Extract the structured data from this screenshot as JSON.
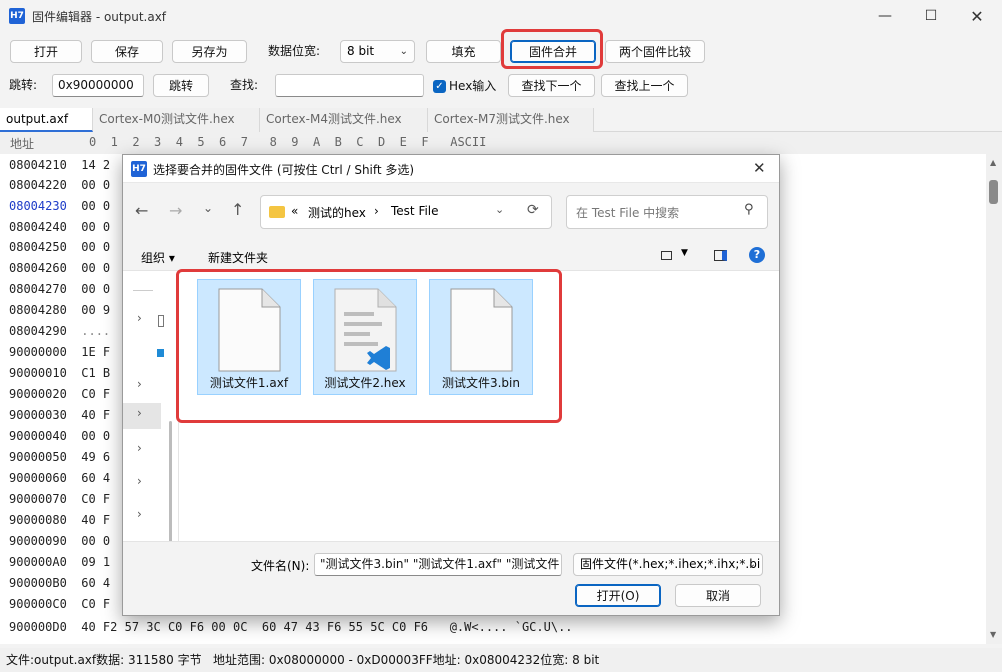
{
  "window": {
    "icon": "H7",
    "title": "固件编辑器 - output.axf",
    "min_icon": "minimize-icon",
    "max_icon": "maximize-icon",
    "close_icon": "close-icon"
  },
  "toolbar": {
    "open": "打开",
    "save": "保存",
    "save_as": "另存为",
    "width_label": "数据位宽:",
    "width_value": "8 bit",
    "fill": "填充",
    "merge": "固件合并",
    "compare": "两个固件比较"
  },
  "toolbar2": {
    "jump_label": "跳转:",
    "jump_value": "0x90000000",
    "jump_btn": "跳转",
    "find_label": "查找:",
    "find_value": "",
    "hex_input_label": "Hex输入",
    "hex_input_checked": true,
    "find_next": "查找下一个",
    "find_prev": "查找上一个"
  },
  "tabs": [
    "output.axf",
    "Cortex-M0测试文件.hex",
    "Cortex-M4测试文件.hex",
    "Cortex-M7测试文件.hex"
  ],
  "hex": {
    "header_addr": "地址",
    "header_cols": "0  1  2  3  4  5  6  7   8  9  A  B  C  D  E  F   ASCII",
    "rows": [
      {
        "addr": "08004210",
        "bytes": "14 2"
      },
      {
        "addr": "08004220",
        "bytes": "00 0"
      },
      {
        "addr": "08004230",
        "bytes": "00 0"
      },
      {
        "addr": "08004240",
        "bytes": "00 0"
      },
      {
        "addr": "08004250",
        "bytes": "00 0"
      },
      {
        "addr": "08004260",
        "bytes": "00 0"
      },
      {
        "addr": "08004270",
        "bytes": "00 0"
      },
      {
        "addr": "08004280",
        "bytes": "00 9"
      },
      {
        "addr": "08004290",
        "bytes": "...."
      },
      {
        "addr": "90000000",
        "bytes": "1E F"
      },
      {
        "addr": "90000010",
        "bytes": "C1 B"
      },
      {
        "addr": "90000020",
        "bytes": "C0 F"
      },
      {
        "addr": "90000030",
        "bytes": "40 F"
      },
      {
        "addr": "90000040",
        "bytes": "00 0"
      },
      {
        "addr": "90000050",
        "bytes": "49 6"
      },
      {
        "addr": "90000060",
        "bytes": "60 4"
      },
      {
        "addr": "90000070",
        "bytes": "C0 F"
      },
      {
        "addr": "90000080",
        "bytes": "40 F"
      },
      {
        "addr": "90000090",
        "bytes": "00 0"
      },
      {
        "addr": "900000A0",
        "bytes": "09 1"
      },
      {
        "addr": "900000B0",
        "bytes": "60 4"
      },
      {
        "addr": "900000C0",
        "bytes": "C0 F"
      },
      {
        "addr": "900000D0",
        "bytes": "40 F2 57 3C C0 F6 00 0C  60 47 43 F6 55 5C C0 F6   @.W<.... `GC.U\\.."
      }
    ]
  },
  "status": {
    "text": "文件:output.axf数据: 311580 字节   地址范围: 0x08000000 - 0xD00003FF地址: 0x08004232位宽: 8 bit"
  },
  "dialog": {
    "icon": "H7",
    "title": "选择要合并的固件文件 (可按住 Ctrl / Shift 多选)",
    "breadcrumb_sep": "«",
    "breadcrumb_parent": "测试的hex",
    "breadcrumb_arrow": "›",
    "breadcrumb_current": "Test File",
    "search_placeholder": "在 Test File 中搜索",
    "organize": "组织",
    "new_folder": "新建文件夹",
    "files": [
      {
        "name": "测试文件1.axf",
        "icon": "blank-file-icon"
      },
      {
        "name": "测试文件2.hex",
        "icon": "vscode-file-icon"
      },
      {
        "name": "测试文件3.bin",
        "icon": "blank-file-icon"
      }
    ],
    "filename_label": "文件名(N):",
    "filename_value": "\"测试文件3.bin\" \"测试文件1.axf\" \"测试文件",
    "filter_value": "固件文件(*.hex;*.ihex;*.ihx;*.bi",
    "open_btn": "打开(O)",
    "cancel_btn": "取消"
  },
  "colors": {
    "highlight": "#e03b3b",
    "accent": "#0a65c2",
    "selected_file": "#cce8ff"
  }
}
